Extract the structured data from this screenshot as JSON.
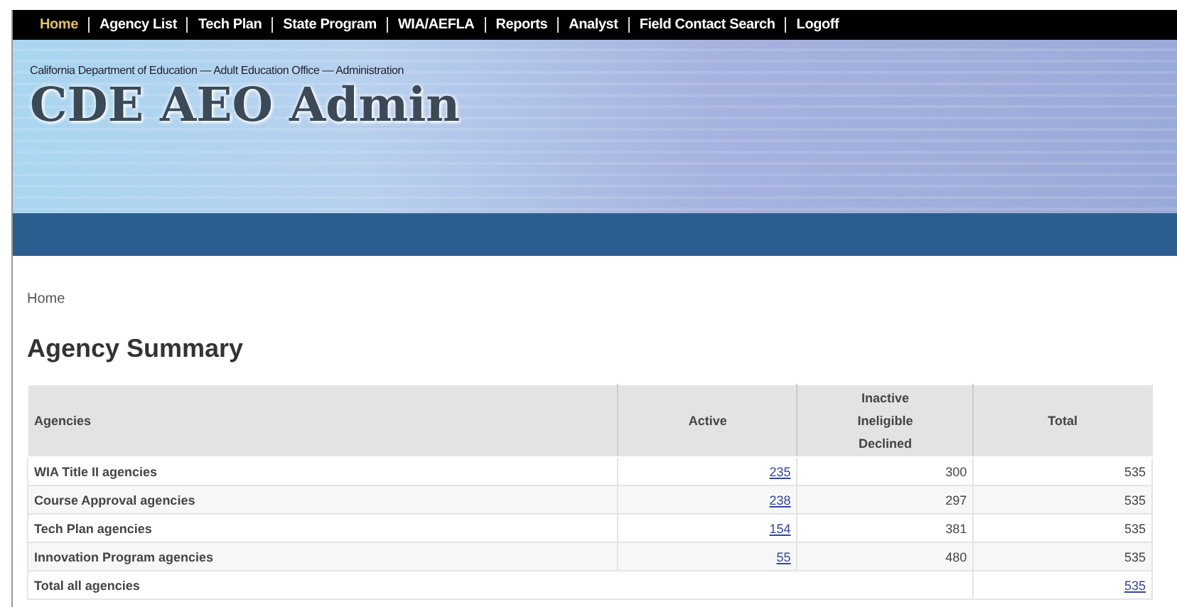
{
  "nav": [
    {
      "label": "Home",
      "selected": true
    },
    {
      "label": "Agency List",
      "selected": false
    },
    {
      "label": "Tech Plan",
      "selected": false
    },
    {
      "label": "State Program",
      "selected": false
    },
    {
      "label": "WIA/AEFLA",
      "selected": false
    },
    {
      "label": "Reports",
      "selected": false
    },
    {
      "label": "Analyst",
      "selected": false
    },
    {
      "label": "Field Contact Search",
      "selected": false
    },
    {
      "label": "Logoff",
      "selected": false
    }
  ],
  "header": {
    "subtitle": "California Department of Education — Adult Education Office — Administration",
    "title": "CDE AEO Admin"
  },
  "breadcrumb": "Home",
  "heading": "Agency Summary",
  "table": {
    "columns": [
      "Agencies",
      "Active",
      "Inactive\nIneligible\nDeclined",
      "Total"
    ],
    "rows": [
      {
        "kind": "agency",
        "cells": [
          {
            "text": "WIA Title II agencies",
            "link": false
          },
          {
            "text": "235",
            "link": true
          },
          {
            "text": "300",
            "link": false
          },
          {
            "text": "535",
            "link": false
          }
        ]
      },
      {
        "kind": "agency",
        "cells": [
          {
            "text": "Course Approval agencies",
            "link": false
          },
          {
            "text": "238",
            "link": true
          },
          {
            "text": "297",
            "link": false
          },
          {
            "text": "535",
            "link": false
          }
        ]
      },
      {
        "kind": "agency",
        "cells": [
          {
            "text": "Tech Plan agencies",
            "link": false
          },
          {
            "text": "154",
            "link": true
          },
          {
            "text": "381",
            "link": false
          },
          {
            "text": "535",
            "link": false
          }
        ]
      },
      {
        "kind": "agency",
        "cells": [
          {
            "text": "Innovation Program agencies",
            "link": false
          },
          {
            "text": "55",
            "link": true
          },
          {
            "text": "480",
            "link": false
          },
          {
            "text": "535",
            "link": false
          }
        ]
      },
      {
        "kind": "total",
        "cells": [
          {
            "text": "Total all agencies",
            "link": false,
            "colspan": 3
          },
          {
            "text": "535",
            "link": true
          }
        ]
      }
    ]
  }
}
